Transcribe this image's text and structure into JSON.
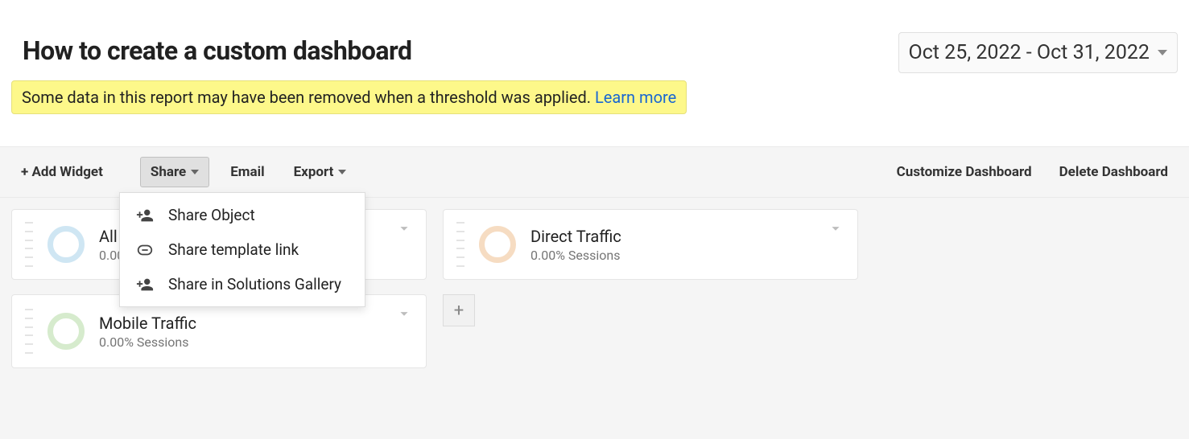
{
  "page_title": "How to create a custom dashboard",
  "date_range": "Oct 25, 2022 - Oct 31, 2022",
  "notice": {
    "text": "Some data in this report may have been removed when a threshold was applied. ",
    "link_label": "Learn more"
  },
  "toolbar": {
    "add_widget": "+ Add Widget",
    "share": "Share",
    "email": "Email",
    "export": "Export",
    "customize": "Customize Dashboard",
    "delete": "Delete Dashboard"
  },
  "share_menu": {
    "share_object": "Share Object",
    "share_template_link": "Share template link",
    "share_solutions_gallery": "Share in Solutions Gallery"
  },
  "widgets": [
    {
      "title": "All Users",
      "subtitle": "0.00% Sessions",
      "ring": "blue"
    },
    {
      "title": "Direct Traffic",
      "subtitle": "0.00% Sessions",
      "ring": "orange"
    },
    {
      "title": "Mobile Traffic",
      "subtitle": "0.00% Sessions",
      "ring": "green"
    }
  ],
  "icons": {
    "plus": "+"
  }
}
